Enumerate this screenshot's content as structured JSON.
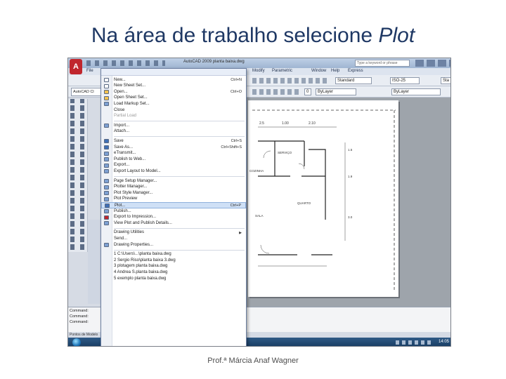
{
  "slide": {
    "title_main": "Na área de trabalho selecione ",
    "title_emphasis": "Plot",
    "credit": "Prof.ª Márcia Anaf Wagner"
  },
  "window": {
    "title": "AutoCAD 2009    planta baixa.dwg",
    "search_placeholder": "Type a keyword or phrase",
    "doc_tab": "AutoCAD Cl",
    "app_button_glyph": "A"
  },
  "menubar": {
    "items": [
      "File",
      "Modify",
      "Parametric",
      "Window",
      "Help",
      "Express"
    ]
  },
  "toolbars": {
    "textstyle": "Standard",
    "dimstyle": "ISO-25",
    "tablestyle": "Sta",
    "linetype": "ByLayer",
    "lineweight": "ByLayer",
    "layer_num": "0"
  },
  "drawing": {
    "dim_labels": [
      "2.5",
      "1.00",
      "2.10"
    ],
    "room_labels": [
      "SERVIÇO",
      "COZINHA",
      "QUARTO",
      "SALA"
    ],
    "side_dims": [
      "1.5",
      "1.9",
      "3.0"
    ]
  },
  "app_menu": {
    "items": [
      {
        "label": "New...",
        "shortcut": "Ctrl+N",
        "icon_color": "#ffffff"
      },
      {
        "label": "New Sheet Set...",
        "shortcut": "",
        "icon_color": "#ffffff"
      },
      {
        "label": "Open...",
        "shortcut": "Ctrl+O",
        "icon_color": "#f2c14e"
      },
      {
        "label": "Open Sheet Set...",
        "shortcut": "",
        "icon_color": "#f2c14e"
      },
      {
        "label": "Load Markup Set...",
        "shortcut": "",
        "icon_color": "#7da0d2"
      },
      {
        "label": "Close",
        "shortcut": "",
        "icon_color": "transparent"
      },
      {
        "label": "Partial Load",
        "shortcut": "",
        "icon_color": "transparent",
        "dim": true
      },
      {
        "sep": true
      },
      {
        "label": "Import...",
        "shortcut": "",
        "icon_color": "#7da0d2"
      },
      {
        "label": "Attach...",
        "shortcut": "",
        "icon_color": "transparent"
      },
      {
        "sep": true
      },
      {
        "label": "Save",
        "shortcut": "Ctrl+S",
        "icon_color": "#3f6fb5"
      },
      {
        "label": "Save As...",
        "shortcut": "Ctrl+Shift+S",
        "icon_color": "#3f6fb5"
      },
      {
        "label": "eTransmit...",
        "shortcut": "",
        "icon_color": "#7da0d2"
      },
      {
        "label": "Publish to Web...",
        "shortcut": "",
        "icon_color": "#7da0d2"
      },
      {
        "label": "Export...",
        "shortcut": "",
        "icon_color": "#7da0d2"
      },
      {
        "label": "Export Layout to Model...",
        "shortcut": "",
        "icon_color": "#7da0d2"
      },
      {
        "sep": true
      },
      {
        "label": "Page Setup Manager...",
        "shortcut": "",
        "icon_color": "#7da0d2"
      },
      {
        "label": "Plotter Manager...",
        "shortcut": "",
        "icon_color": "#7da0d2"
      },
      {
        "label": "Plot Style Manager...",
        "shortcut": "",
        "icon_color": "#7da0d2"
      },
      {
        "label": "Plot Preview",
        "shortcut": "",
        "icon_color": "#7da0d2"
      },
      {
        "label": "Plot...",
        "shortcut": "Ctrl+P",
        "icon_color": "#3f6fb5",
        "selected": true
      },
      {
        "label": "Publish...",
        "shortcut": "",
        "icon_color": "#7da0d2"
      },
      {
        "label": "Export to Impression...",
        "shortcut": "",
        "icon_color": "#c0262d"
      },
      {
        "label": "View Plot and Publish Details...",
        "shortcut": "",
        "icon_color": "#7da0d2"
      },
      {
        "sep": true
      },
      {
        "label": "Drawing Utilities",
        "shortcut": "",
        "icon_color": "transparent",
        "submenu": true
      },
      {
        "label": "Send...",
        "shortcut": "",
        "icon_color": "transparent"
      },
      {
        "label": "Drawing Properties...",
        "shortcut": "",
        "icon_color": "#7da0d2"
      },
      {
        "sep": true
      },
      {
        "label": "1 C:\\Users\\...\\planta baixa.dwg",
        "shortcut": "",
        "icon_color": "transparent"
      },
      {
        "label": "2 Sergio Riso\\planta baixa 3.dwg",
        "shortcut": "",
        "icon_color": "transparent"
      },
      {
        "label": "3 plotagem planta baixa.dwg",
        "shortcut": "",
        "icon_color": "transparent"
      },
      {
        "label": "4 Andrea S.planta baixa.dwg",
        "shortcut": "",
        "icon_color": "transparent"
      },
      {
        "label": "5 exemplo planta baixa.dwg",
        "shortcut": "",
        "icon_color": "transparent"
      }
    ]
  },
  "command_line": {
    "lines": [
      "Command:",
      "Command:",
      "Command:"
    ]
  },
  "status_bar": {
    "coords": "Pontos de Modelo"
  },
  "taskbar": {
    "clock": "14:05"
  }
}
